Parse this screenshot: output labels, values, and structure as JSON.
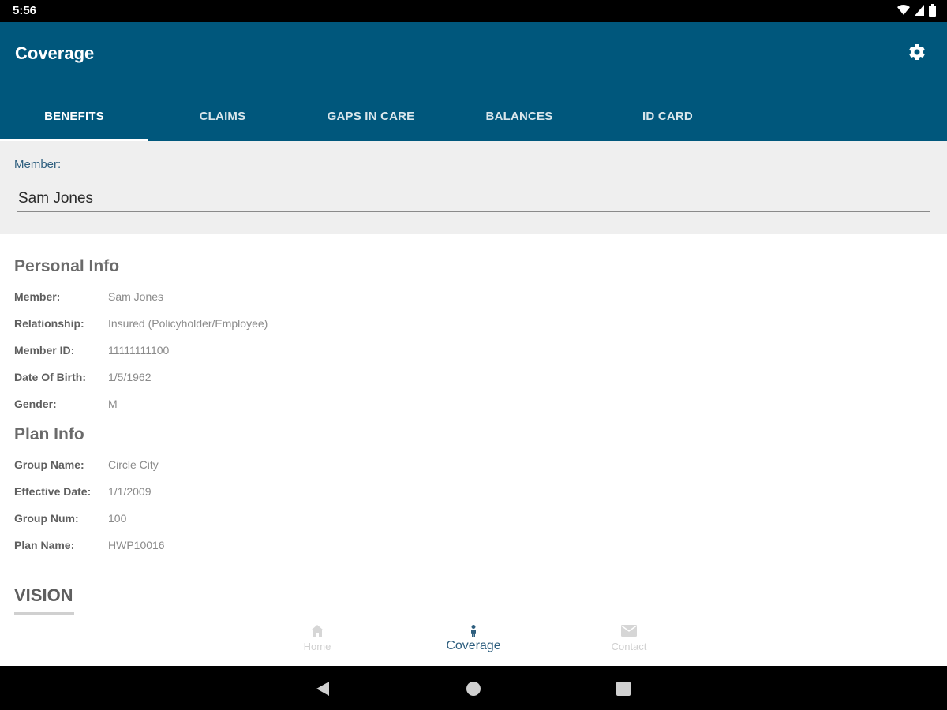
{
  "status_bar": {
    "time": "5:56",
    "icons": [
      "wifi-icon",
      "signal-icon",
      "battery-icon"
    ]
  },
  "app_bar": {
    "title": "Coverage",
    "settings_icon": "gear-icon",
    "color": "#00577c"
  },
  "tabs": [
    {
      "label": "BENEFITS",
      "active": true
    },
    {
      "label": "CLAIMS",
      "active": false
    },
    {
      "label": "GAPS IN CARE",
      "active": false
    },
    {
      "label": "BALANCES",
      "active": false
    },
    {
      "label": "ID CARD",
      "active": false
    }
  ],
  "member_selector": {
    "label": "Member:",
    "value": "Sam Jones"
  },
  "personal_info": {
    "heading": "Personal Info",
    "rows": [
      {
        "label": "Member:",
        "value": "Sam Jones"
      },
      {
        "label": "Relationship:",
        "value": "Insured (Policyholder/Employee)"
      },
      {
        "label": "Member ID:",
        "value": "11111111100"
      },
      {
        "label": "Date Of Birth:",
        "value": "1/5/1962"
      },
      {
        "label": "Gender:",
        "value": "M"
      }
    ]
  },
  "plan_info": {
    "heading": "Plan Info",
    "rows": [
      {
        "label": "Group Name:",
        "value": "Circle City"
      },
      {
        "label": "Effective Date:",
        "value": "1/1/2009"
      },
      {
        "label": "Group Num:",
        "value": "100"
      },
      {
        "label": "Plan Name:",
        "value": "HWP10016"
      }
    ]
  },
  "vision": {
    "heading": "VISION"
  },
  "bottom_nav": [
    {
      "label": "Home",
      "icon": "home-icon",
      "active": false
    },
    {
      "label": "Coverage",
      "icon": "person-icon",
      "active": true
    },
    {
      "label": "Contact",
      "icon": "envelope-icon",
      "active": false
    }
  ],
  "system_nav": [
    "back-icon",
    "home-circle-icon",
    "recents-icon"
  ]
}
